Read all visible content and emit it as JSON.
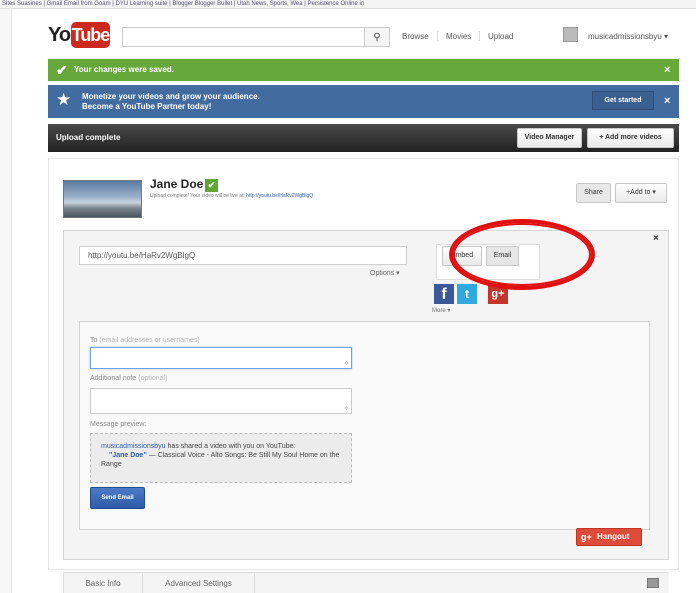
{
  "bookmarks": {
    "text": "Sites Suasines  |  Gmail Email from Goam  |  DYU Learning suite  |  Blogger Blogger Bullet  |  Utah News, Sports, Wea  |  Persistence Online in"
  },
  "header": {
    "logo_you": "You",
    "logo_tube": "Tube",
    "search_placeholder": "",
    "search_icon": "magnifier-icon",
    "nav": [
      "Browse",
      "Movies",
      "Upload"
    ],
    "username": "musicadmissionsbyu ▾"
  },
  "alerts": {
    "saved": "Your changes were saved.",
    "partner_line1": "Monetize your videos and grow your audience.",
    "partner_line2": "Become a YouTube Partner today!",
    "get_started": "Get started",
    "close": "×"
  },
  "upload_bar": {
    "status": "Upload complete",
    "video_manager": "Video Manager",
    "add_more": "+ Add more videos"
  },
  "video": {
    "title": "Jane Doe",
    "subtitle": "Upload complete! Your video will be live at:",
    "link": "http://youtu.be/HaRv2WgBlgQ",
    "share_btn": "Share",
    "add_to_btn": "+Add to ▾"
  },
  "share": {
    "close": "×",
    "url": "http://youtu.be/HaRv2WgBlgQ",
    "options": "Options ▾",
    "embed": "Embed",
    "email": "Email",
    "facebook": "f",
    "twitter": "t",
    "gplus": "g+",
    "more": "More ▾"
  },
  "email_form": {
    "to_label": "To",
    "to_hint": "(email addresses or usernames)",
    "note_label": "Additional note",
    "note_hint": "(optional)",
    "preview_label": "Message preview:",
    "preview_user": "musicadmissionsbyu",
    "preview_text": " has shared a video with you on YouTube:",
    "preview_title": "\"Jane Doe\"",
    "preview_desc": " — Classical Voice - Alto Songs: Be Still My Soul Home on the Range",
    "send": "Send Email"
  },
  "hangout": {
    "icon": "g+",
    "label": "Hangout"
  },
  "tabs": [
    "Basic Info",
    "Advanced Settings"
  ],
  "colors": {
    "green": "#66a93a",
    "blue": "#426b9f",
    "red": "#cc2a1f",
    "annotation": "#e01010"
  }
}
